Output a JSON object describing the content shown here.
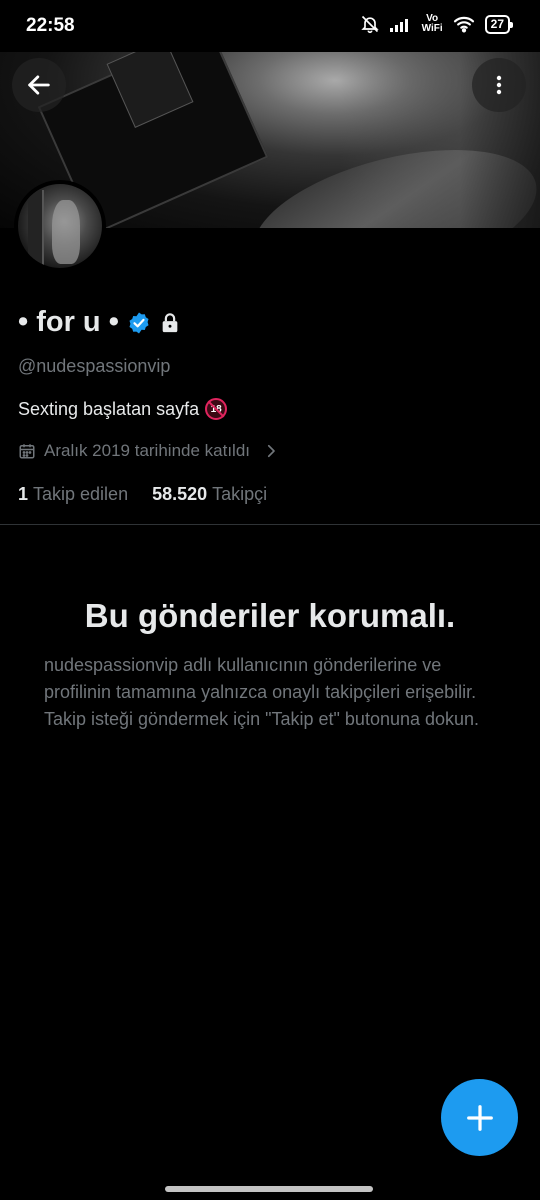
{
  "status_bar": {
    "time": "22:58",
    "network_label_top": "Vo",
    "network_label_bottom": "WiFi",
    "battery": "27"
  },
  "header": {
    "back_icon": "arrow-left-icon",
    "more_icon": "more-vertical-icon"
  },
  "profile": {
    "display_name": "• for u •",
    "verified": true,
    "protected": true,
    "handle": "@nudespassionvip",
    "bio": "Sexting başlatan sayfa",
    "bio_emoji": "18",
    "joined": "Aralık 2019 tarihinde katıldı",
    "following_count": "1",
    "following_label": "Takip edilen",
    "followers_count": "58.520",
    "followers_label": "Takipçi"
  },
  "protected_notice": {
    "title": "Bu gönderiler korumalı.",
    "body": "nudespassionvip adlı kullanıcının gönderilerine ve profilinin tamamına yalnızca onaylı takipçileri erişebilir. Takip isteği göndermek için \"Takip et\" butonuna dokun."
  },
  "fab": {
    "icon": "plus-icon"
  },
  "colors": {
    "accent": "#1d9bf0",
    "background": "#000000",
    "primary_text": "#e7e9ea",
    "secondary_text": "#71767b"
  }
}
